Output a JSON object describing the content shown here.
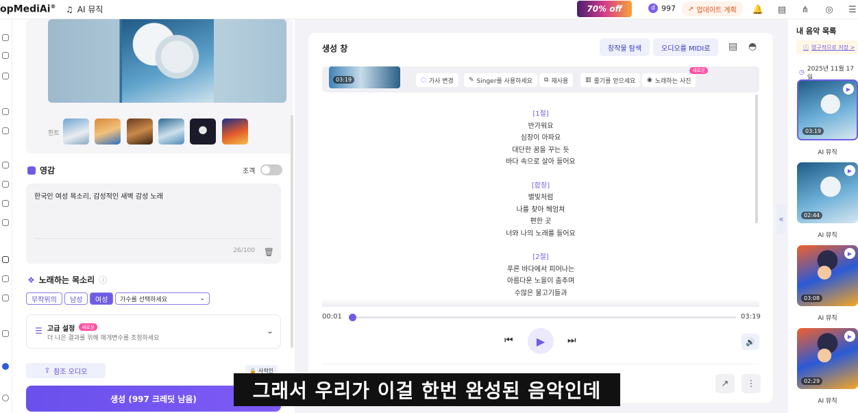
{
  "topbar": {
    "logo": "opMediAi",
    "logo_reg": "®",
    "music_tab": "AI 뮤직",
    "promo": "70% off",
    "credits": "997",
    "upgrade": "업데이트 계획",
    "notif_count": "1"
  },
  "left": {
    "hint_label": "힌트",
    "inspiration_title": "영감",
    "toggle_label": "조격",
    "prompt_text": "한국인 여성 목소리, 감성적인 새벽 감성 노래",
    "prompt_counter": "26/100",
    "voice_title": "노래하는 목소리",
    "voice_chips": [
      "무작위의",
      "남성",
      "여성"
    ],
    "voice_select": "가수를 선택하세요",
    "advanced_title": "고급 설정",
    "advanced_badge": "새로운",
    "advanced_desc": "더 나은 결과를 위해 매개변수를 조정하세요",
    "ref_audio": "참조 오디오",
    "private": "사적인",
    "generate": "생성 (997 크레딧 남음)"
  },
  "center": {
    "title": "생성 창",
    "explore_btn": "창작물 탐색",
    "midi_btn": "오디오를 MIDI로",
    "thumb_duration": "03:19",
    "tools": [
      "가사 변경",
      "Singer를 사용하세요",
      "재사용",
      "줄기를 얻으세요",
      "노래하는 사진"
    ],
    "tool_new_badge": "새로운",
    "lyrics": [
      {
        "tag": "[1절]"
      },
      {
        "line": "반가워요"
      },
      {
        "line": "심장이 아파요"
      },
      {
        "line": "대단한 꿈을 꾸는 듯"
      },
      {
        "line": "바다 속으로 살아 들어요"
      },
      {
        "gap": true
      },
      {
        "tag": "[합창]"
      },
      {
        "line": "별빛처럼"
      },
      {
        "line": "나를 찾아 헤엄쳐"
      },
      {
        "line": "편한 곳"
      },
      {
        "line": "너와 나의 노래를 들어요"
      },
      {
        "gap": true
      },
      {
        "tag": "[2절]"
      },
      {
        "line": "푸른 바다에서 피어나는"
      },
      {
        "line": "아름다운 노을이 춤추며"
      },
      {
        "line": "수많은 물고기들과"
      }
    ],
    "time_current": "00:01",
    "time_total": "03:19",
    "progress": 0.003
  },
  "right": {
    "title": "내 음악 목록",
    "save_note": "영구적으로 저장 >",
    "date": "2025년 11월 17일",
    "cards": [
      {
        "duration": "03:19",
        "label": "AI 뮤직"
      },
      {
        "duration": "02:44",
        "label": "AI 뮤직"
      },
      {
        "duration": "03:08",
        "label": "AI 뮤직"
      },
      {
        "duration": "02:29",
        "label": "AI 뮤직"
      }
    ]
  },
  "subtitle": "그래서 우리가 이걸 한번 완성된 음악인데",
  "colors": {
    "accent": "#6e5ce6",
    "pink_badge": "#ff4fa3",
    "upgrade": "#e0561a"
  }
}
